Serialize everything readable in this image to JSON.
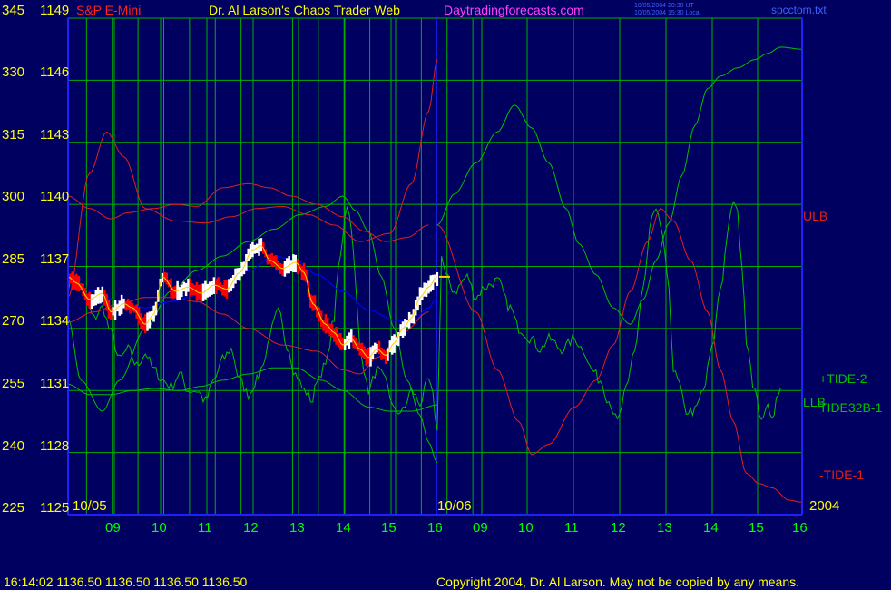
{
  "header": {
    "instrument": "S&P E-Mini",
    "site_title": "Dr. Al Larson's Chaos Trader Web",
    "site_url": "Daytradingforecasts.com",
    "timestamp_ut": "10/05/2004 20:30 UT",
    "timestamp_local": "10/05/2004 15:30 Local",
    "filename": "spcctom.txt"
  },
  "footer": {
    "quote": "16:14:02  1136.50 1136.50 1136.50 1136.50",
    "copyright": "Copyright 2004, Dr. Al Larson. May not be copied by any means."
  },
  "colors": {
    "background": "#000060",
    "grid": "#00b000",
    "axis": "#2020ff",
    "left_labels": "#ffff00",
    "time_labels": "#00ff00",
    "price_down_bars": "#ff0000",
    "price_up_bars": "#ffffff",
    "red_lines": "#e02020",
    "green_lines": "#00c000",
    "blue_line": "#0000ff",
    "marker": "#ffd000"
  },
  "chart_data": {
    "type": "line",
    "title": "S&P E-Mini",
    "y_axes": {
      "oscillator_ticks": [
        "345",
        "330",
        "315",
        "300",
        "285",
        "270",
        "255",
        "240",
        "225"
      ],
      "price_ticks": [
        "1149",
        "1146",
        "1143",
        "1140",
        "1137",
        "1134",
        "1131",
        "1128",
        "1125"
      ],
      "price_range": [
        1125,
        1149
      ],
      "oscillator_range": [
        225,
        345
      ]
    },
    "x_axis": {
      "hour_ticks": [
        "09",
        "10",
        "11",
        "12",
        "13",
        "14",
        "15",
        "16",
        "09",
        "10",
        "11",
        "12",
        "13",
        "14",
        "15",
        "16"
      ],
      "date_labels": [
        "10/05",
        "10/06"
      ],
      "year_label": "2004"
    },
    "grid": true,
    "series_labels": [
      "ULB",
      "+TIDE-2",
      "LLB",
      "TIDE32B-1",
      "-TIDE-1"
    ],
    "price_anchors": [
      [
        0,
        1136.5
      ],
      [
        2,
        1136.2
      ],
      [
        5,
        1135.4
      ],
      [
        8,
        1135.7
      ],
      [
        10,
        1134.8
      ],
      [
        13,
        1135.2
      ],
      [
        15,
        1135.0
      ],
      [
        18,
        1134.2
      ],
      [
        20,
        1134.7
      ],
      [
        22,
        1136.5
      ],
      [
        25,
        1135.8
      ],
      [
        28,
        1136.0
      ],
      [
        31,
        1135.7
      ],
      [
        34,
        1136.1
      ],
      [
        37,
        1135.9
      ],
      [
        40,
        1136.7
      ],
      [
        43,
        1137.8
      ],
      [
        45,
        1138.0
      ],
      [
        47,
        1137.3
      ],
      [
        50,
        1136.9
      ],
      [
        53,
        1137.2
      ],
      [
        55,
        1136.7
      ],
      [
        57,
        1135.2
      ],
      [
        60,
        1134.2
      ],
      [
        62,
        1133.8
      ],
      [
        64,
        1133.2
      ],
      [
        66,
        1133.5
      ],
      [
        68,
        1133.0
      ],
      [
        70,
        1132.6
      ],
      [
        72,
        1133.0
      ],
      [
        74,
        1132.7
      ],
      [
        76,
        1133.3
      ],
      [
        78,
        1134.0
      ],
      [
        80,
        1134.5
      ],
      [
        82,
        1135.5
      ],
      [
        84,
        1136.0
      ],
      [
        86,
        1136.5
      ]
    ],
    "red_line_upper": [
      [
        0,
        1140.4
      ],
      [
        5,
        1139.8
      ],
      [
        10,
        1139.3
      ],
      [
        14,
        1139.6
      ],
      [
        20,
        1139.8
      ],
      [
        25,
        1140.0
      ],
      [
        30,
        1139.9
      ],
      [
        36,
        1140.8
      ],
      [
        42,
        1141.0
      ],
      [
        47,
        1140.8
      ],
      [
        52,
        1140.4
      ],
      [
        58,
        1140.0
      ],
      [
        64,
        1139.4
      ],
      [
        69,
        1138.7
      ],
      [
        74,
        1138.2
      ],
      [
        79,
        1138.4
      ],
      [
        84,
        1139.0
      ]
    ],
    "red_line_lower": [
      [
        0,
        1134.3
      ],
      [
        6,
        1134.8
      ],
      [
        12,
        1135.2
      ],
      [
        18,
        1135.5
      ],
      [
        24,
        1135.5
      ],
      [
        30,
        1135.3
      ],
      [
        36,
        1134.7
      ],
      [
        42,
        1134.0
      ],
      [
        50,
        1133.2
      ],
      [
        58,
        1132.9
      ],
      [
        64,
        1132.0
      ],
      [
        68,
        1131.8
      ],
      [
        72,
        1132.6
      ],
      [
        78,
        1133.8
      ],
      [
        84,
        1134.8
      ]
    ],
    "red_forecast": [
      [
        0,
        1135.5
      ],
      [
        5,
        1141.5
      ],
      [
        9,
        1143.5
      ],
      [
        13,
        1142.3
      ],
      [
        18,
        1139.8
      ],
      [
        25,
        1139.2
      ],
      [
        32,
        1139.1
      ],
      [
        38,
        1139.4
      ],
      [
        44,
        1139.8
      ],
      [
        50,
        1139.9
      ],
      [
        56,
        1139.5
      ],
      [
        62,
        1139.0
      ],
      [
        68,
        1138.2
      ],
      [
        75,
        1138.6
      ],
      [
        80,
        1141.0
      ],
      [
        84,
        1144.5
      ],
      [
        86,
        1147.0
      ]
    ],
    "red_forecast_future": [
      [
        86,
        1139.0
      ],
      [
        95,
        1134.8
      ],
      [
        100,
        1132.0
      ],
      [
        105,
        1129.5
      ],
      [
        108,
        1127.9
      ],
      [
        112,
        1128.4
      ],
      [
        118,
        1130.2
      ],
      [
        123,
        1131.5
      ],
      [
        127,
        1133.2
      ],
      [
        131,
        1135.8
      ],
      [
        135,
        1138.2
      ],
      [
        138,
        1139.8
      ],
      [
        141,
        1139.2
      ],
      [
        145,
        1137.3
      ],
      [
        149,
        1134.8
      ],
      [
        152,
        1132.0
      ],
      [
        155,
        1129.5
      ],
      [
        158,
        1127.0
      ],
      [
        161,
        1126.5
      ],
      [
        164,
        1126.3
      ],
      [
        168,
        1125.7
      ],
      [
        171,
        1125.6
      ]
    ],
    "green_forecast": [
      [
        0,
        1131.3
      ],
      [
        5,
        1130.8
      ],
      [
        10,
        1130.8
      ],
      [
        15,
        1131.0
      ],
      [
        20,
        1131.1
      ],
      [
        26,
        1131.0
      ],
      [
        31,
        1131.2
      ],
      [
        36,
        1131.5
      ],
      [
        42,
        1131.8
      ],
      [
        48,
        1132.1
      ],
      [
        53,
        1132.1
      ],
      [
        59,
        1131.5
      ],
      [
        64,
        1131.0
      ],
      [
        70,
        1130.2
      ],
      [
        75,
        1130.0
      ],
      [
        80,
        1130.0
      ],
      [
        86,
        1130.3
      ]
    ],
    "green_forecast_main": [
      [
        0,
        1134.5
      ],
      [
        3,
        1131.5
      ],
      [
        8,
        1130.0
      ],
      [
        12,
        1131.5
      ],
      [
        18,
        1134.0
      ],
      [
        24,
        1135.8
      ],
      [
        30,
        1136.8
      ],
      [
        36,
        1137.5
      ],
      [
        42,
        1138.2
      ],
      [
        48,
        1138.8
      ],
      [
        54,
        1139.5
      ],
      [
        60,
        1139.9
      ],
      [
        64,
        1140.4
      ],
      [
        67,
        1139.7
      ],
      [
        70,
        1138.7
      ],
      [
        73,
        1136.5
      ],
      [
        76,
        1134.0
      ],
      [
        79,
        1131.5
      ],
      [
        82,
        1129.8
      ],
      [
        84,
        1128.5
      ],
      [
        86,
        1127.5
      ]
    ],
    "green_forecast_future": [
      [
        86,
        1139.0
      ],
      [
        90,
        1140.5
      ],
      [
        95,
        1142.0
      ],
      [
        100,
        1143.5
      ],
      [
        104,
        1144.8
      ],
      [
        108,
        1143.7
      ],
      [
        112,
        1142.0
      ],
      [
        116,
        1139.8
      ],
      [
        119,
        1138.1
      ],
      [
        123,
        1136.6
      ],
      [
        127,
        1135.0
      ],
      [
        131,
        1134.2
      ],
      [
        134,
        1135.4
      ],
      [
        137,
        1137.3
      ],
      [
        140,
        1139.1
      ],
      [
        143,
        1141.4
      ],
      [
        146,
        1143.8
      ],
      [
        149,
        1145.6
      ],
      [
        152,
        1146.2
      ],
      [
        156,
        1146.6
      ],
      [
        160,
        1147.0
      ],
      [
        163,
        1147.3
      ],
      [
        166,
        1147.6
      ],
      [
        171,
        1147.5
      ]
    ],
    "blue_anchors": [
      [
        0,
        1136.3
      ],
      [
        6,
        1135.8
      ],
      [
        12,
        1135.3
      ],
      [
        18,
        1135.0
      ],
      [
        24,
        1135.3
      ],
      [
        30,
        1135.6
      ],
      [
        36,
        1136.0
      ],
      [
        42,
        1136.8
      ],
      [
        48,
        1137.5
      ],
      [
        53,
        1137.3
      ],
      [
        58,
        1136.6
      ],
      [
        64,
        1135.8
      ],
      [
        70,
        1134.9
      ],
      [
        76,
        1134.4
      ],
      [
        80,
        1134.3
      ],
      [
        84,
        1135.0
      ],
      [
        86,
        1135.5
      ]
    ],
    "tide_anchors": [
      [
        0,
        1136.0
      ],
      [
        2,
        1136.5
      ],
      [
        4,
        1135.5
      ],
      [
        6,
        1134.5
      ],
      [
        8,
        1135.0
      ],
      [
        10,
        1133.8
      ],
      [
        12,
        1132.5
      ],
      [
        14,
        1133.0
      ],
      [
        16,
        1132.2
      ],
      [
        18,
        1132.8
      ],
      [
        20,
        1132.0
      ],
      [
        22,
        1131.5
      ],
      [
        24,
        1131.2
      ],
      [
        26,
        1131.8
      ],
      [
        28,
        1131.0
      ],
      [
        30,
        1131.0
      ],
      [
        32,
        1130.5
      ],
      [
        34,
        1131.5
      ],
      [
        36,
        1132.5
      ],
      [
        38,
        1133.0
      ],
      [
        40,
        1131.5
      ],
      [
        42,
        1130.8
      ],
      [
        44,
        1131.5
      ],
      [
        46,
        1132.6
      ],
      [
        47,
        1133.8
      ],
      [
        49,
        1134.8
      ],
      [
        51,
        1133.2
      ],
      [
        53,
        1131.8
      ],
      [
        55,
        1131.0
      ],
      [
        57,
        1130.5
      ],
      [
        58,
        1131.6
      ],
      [
        60,
        1132.2
      ],
      [
        62,
        1134.5
      ],
      [
        63,
        1137.0
      ],
      [
        65,
        1140.0
      ],
      [
        66,
        1139.0
      ],
      [
        67,
        1136.0
      ],
      [
        68,
        1133.0
      ],
      [
        70,
        1131.0
      ],
      [
        72,
        1132.0
      ],
      [
        74,
        1131.5
      ],
      [
        76,
        1130.0
      ],
      [
        78,
        1130.0
      ],
      [
        80,
        1131.0
      ],
      [
        82,
        1130.4
      ],
      [
        84,
        1131.5
      ],
      [
        85,
        1130.7
      ],
      [
        86,
        1129.0
      ],
      [
        87,
        1137.5
      ],
      [
        88,
        1136.5
      ],
      [
        90,
        1135.8
      ],
      [
        93,
        1136.5
      ],
      [
        95,
        1135.5
      ],
      [
        97,
        1136.0
      ],
      [
        100,
        1136.3
      ],
      [
        103,
        1135.0
      ],
      [
        105,
        1134.0
      ],
      [
        108,
        1133.5
      ],
      [
        110,
        1133.0
      ],
      [
        112,
        1133.5
      ],
      [
        115,
        1133.0
      ],
      [
        118,
        1133.5
      ],
      [
        120,
        1133.0
      ],
      [
        122,
        1132.0
      ],
      [
        124,
        1131.5
      ],
      [
        126,
        1130.5
      ],
      [
        128,
        1129.5
      ],
      [
        130,
        1131.0
      ],
      [
        132,
        1133.0
      ],
      [
        134,
        1136.0
      ],
      [
        136,
        1139.3
      ],
      [
        137,
        1139.6
      ],
      [
        138,
        1139.0
      ],
      [
        140,
        1136.0
      ],
      [
        141,
        1132.0
      ],
      [
        142,
        1131.5
      ],
      [
        144,
        1130.0
      ],
      [
        146,
        1130.0
      ],
      [
        148,
        1131.0
      ],
      [
        150,
        1133.0
      ],
      [
        152,
        1136.0
      ],
      [
        154,
        1139.0
      ],
      [
        155,
        1140.2
      ],
      [
        156,
        1139.5
      ],
      [
        157,
        1137.0
      ],
      [
        158,
        1133.5
      ],
      [
        160,
        1131.0
      ],
      [
        161,
        1130.0
      ],
      [
        162,
        1129.5
      ],
      [
        163,
        1130.5
      ],
      [
        164,
        1129.6
      ],
      [
        165,
        1130.5
      ],
      [
        166,
        1131.0
      ]
    ]
  }
}
